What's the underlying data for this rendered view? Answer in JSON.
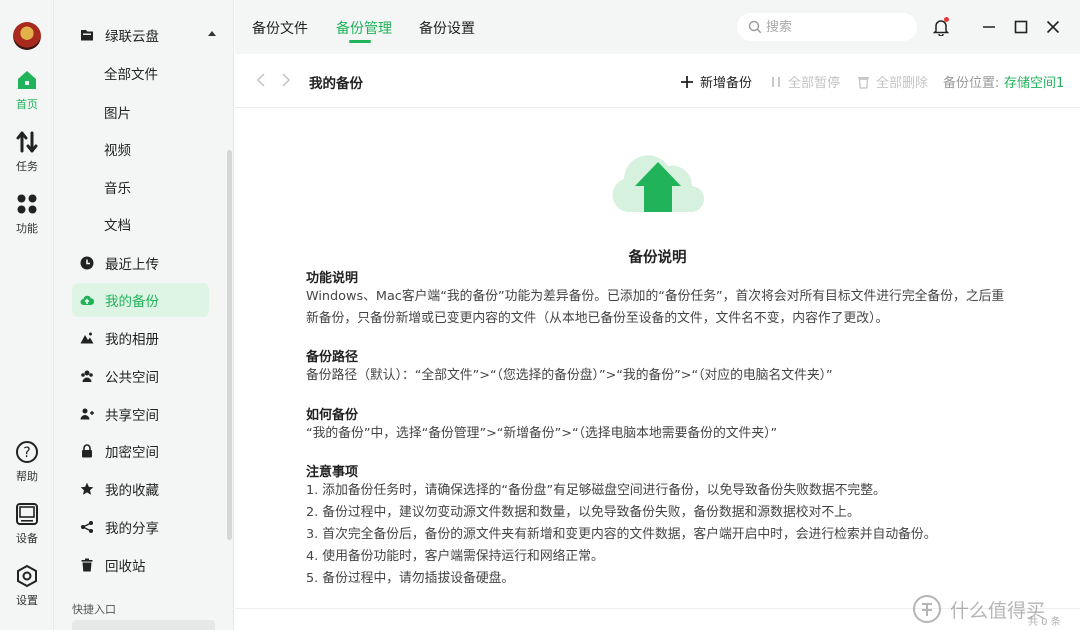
{
  "rail": {
    "items": [
      {
        "label": "首页",
        "icon": "home-icon",
        "active": true
      },
      {
        "label": "任务",
        "icon": "transfer-icon"
      },
      {
        "label": "功能",
        "icon": "apps-icon"
      },
      {
        "label": "帮助",
        "icon": "help-icon"
      },
      {
        "label": "设备",
        "icon": "device-icon"
      },
      {
        "label": "设置",
        "icon": "settings-icon"
      }
    ]
  },
  "sidebar": {
    "cloud_disk": "绿联云盘",
    "sub_items": [
      "全部文件",
      "图片",
      "视频",
      "音乐",
      "文档"
    ],
    "items": [
      {
        "label": "最近上传",
        "icon": "clock-icon"
      },
      {
        "label": "我的备份",
        "icon": "cloud-upload-icon",
        "active": true
      },
      {
        "label": "我的相册",
        "icon": "mountain-icon"
      },
      {
        "label": "公共空间",
        "icon": "group-icon"
      },
      {
        "label": "共享空间",
        "icon": "share-users-icon"
      },
      {
        "label": "加密空间",
        "icon": "lock-icon"
      },
      {
        "label": "我的收藏",
        "icon": "star-icon"
      },
      {
        "label": "我的分享",
        "icon": "share-icon"
      },
      {
        "label": "回收站",
        "icon": "trash-icon"
      }
    ],
    "quick_entry": "快捷入口"
  },
  "topbar": {
    "tabs": [
      {
        "label": "备份文件"
      },
      {
        "label": "备份管理",
        "active": true
      },
      {
        "label": "备份设置"
      }
    ],
    "search_placeholder": "搜索"
  },
  "toolbar": {
    "title": "我的备份",
    "add_backup": "新增备份",
    "pause_all": "全部暂停",
    "delete_all": "全部删除",
    "location_label": "备份位置:",
    "location_value": "存储空间1"
  },
  "doc": {
    "title": "备份说明",
    "sections": [
      {
        "heading": "功能说明",
        "paragraphs": [
          "Windows、Mac客户端“我的备份”功能为差异备份。已添加的“备份任务”，首次将会对所有目标文件进行完全备份，之后重新备份，只备份新增或已变更内容的文件（从本地已备份至设备的文件，文件名不变，内容作了更改）。"
        ]
      },
      {
        "heading": "备份路径",
        "paragraphs": [
          "备份路径（默认）：“全部文件”>“（您选择的备份盘）”>“我的备份”>“（对应的电脑名文件夹）”"
        ]
      },
      {
        "heading": "如何备份",
        "paragraphs": [
          "“我的备份”中，选择“备份管理”>“新增备份”>“（选择电脑本地需要备份的文件夹）”"
        ]
      },
      {
        "heading": "注意事项",
        "paragraphs": [
          "1. 添加备份任务时，请确保选择的“备份盘”有足够磁盘空间进行备份，以免导致备份失败数据不完整。",
          "2. 备份过程中，建议勿变动源文件数据和数量，以免导致备份失败，备份数据和源数据校对不上。",
          "3. 首次完全备份后，备份的源文件夹有新增和变更内容的文件数据，客户端开启中时，会进行检索并自动备份。",
          "4. 使用备份功能时，客户端需保持运行和网络正常。",
          "5. 备份过程中，请勿插拔设备硬盘。"
        ]
      }
    ]
  },
  "watermark": {
    "text": "什么值得买",
    "count": "共 0 条"
  },
  "colors": {
    "accent": "#21b35a",
    "sidebar_bg": "#f4f6f6",
    "active_bg": "#def5e6"
  }
}
